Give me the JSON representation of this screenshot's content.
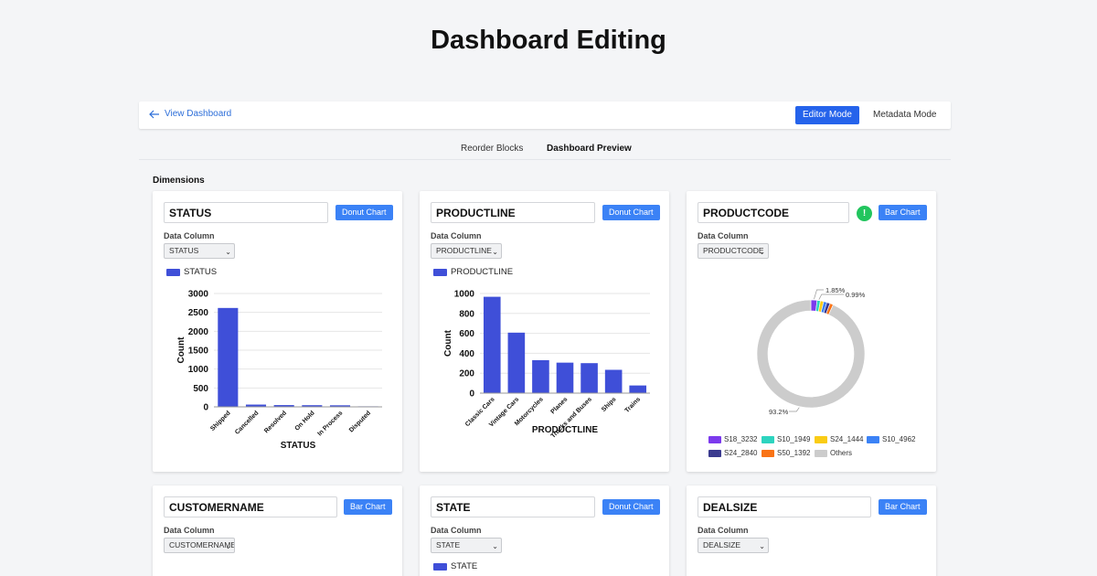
{
  "page": {
    "title": "Dashboard Editing"
  },
  "topbar": {
    "back_label": "View Dashboard",
    "editor_mode": "Editor Mode",
    "metadata_mode": "Metadata Mode"
  },
  "tabs": {
    "reorder": "Reorder Blocks",
    "preview": "Dashboard Preview"
  },
  "section": {
    "label": "Dimensions"
  },
  "colors": {
    "accent": "#2563eb",
    "button": "#3b82f6",
    "bar": "#3f4fd8",
    "success": "#22c55e"
  },
  "cards": [
    {
      "name": "STATUS",
      "chart_button": "Donut Chart",
      "data_column_label": "Data Column",
      "column_value": "STATUS",
      "legend": "STATUS"
    },
    {
      "name": "PRODUCTLINE",
      "chart_button": "Donut Chart",
      "data_column_label": "Data Column",
      "column_value": "PRODUCTLINE",
      "legend": "PRODUCTLINE"
    },
    {
      "name": "PRODUCTCODE",
      "chart_button": "Bar Chart",
      "data_column_label": "Data Column",
      "column_value": "PRODUCTCODE",
      "badge": "!"
    },
    {
      "name": "CUSTOMERNAME",
      "chart_button": "Bar Chart",
      "data_column_label": "Data Column",
      "column_value": "CUSTOMERNAME"
    },
    {
      "name": "STATE",
      "chart_button": "Donut Chart",
      "data_column_label": "Data Column",
      "column_value": "STATE",
      "legend": "STATE"
    },
    {
      "name": "DEALSIZE",
      "chart_button": "Bar Chart",
      "data_column_label": "Data Column",
      "column_value": "DEALSIZE"
    }
  ],
  "chart_data": [
    {
      "type": "bar",
      "categories": [
        "Shipped",
        "Cancelled",
        "Resolved",
        "On Hold",
        "In Process",
        "Disputed"
      ],
      "values": [
        2617,
        60,
        47,
        44,
        41,
        14
      ],
      "xlabel": "STATUS",
      "ylabel": "Count",
      "ylim": [
        0,
        3000
      ],
      "yticks": [
        0,
        500,
        1000,
        1500,
        2000,
        2500,
        3000
      ],
      "grid": true,
      "legend": [
        "STATUS"
      ]
    },
    {
      "type": "bar",
      "categories": [
        "Classic Cars",
        "Vintage Cars",
        "Motorcycles",
        "Planes",
        "Trucks and Buses",
        "Ships",
        "Trains"
      ],
      "values": [
        967,
        607,
        331,
        306,
        301,
        234,
        77
      ],
      "xlabel": "PRODUCTLINE",
      "ylabel": "Count",
      "ylim": [
        0,
        1000
      ],
      "yticks": [
        0,
        200,
        400,
        600,
        800,
        1000
      ],
      "grid": true,
      "legend": [
        "PRODUCTLINE"
      ]
    },
    {
      "type": "pie",
      "donut": true,
      "labels": [
        "S18_3232",
        "S10_1949",
        "S24_1444",
        "S10_4962",
        "S24_2840",
        "S50_1392",
        "Others"
      ],
      "values": [
        1.85,
        0.99,
        0.99,
        0.99,
        0.99,
        0.99,
        93.2
      ],
      "colors": [
        "#7c3aed",
        "#2dd4bf",
        "#facc15",
        "#3b82f6",
        "#3b3b8f",
        "#f97316",
        "#cccccc"
      ],
      "annotations": [
        "1.85%",
        "0.99%",
        "93.2%"
      ],
      "legend_position": "bottom"
    }
  ]
}
